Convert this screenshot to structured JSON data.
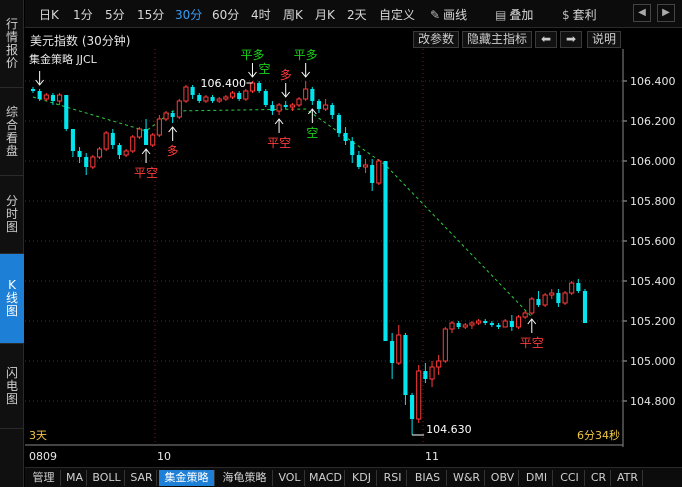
{
  "left_nav": [
    {
      "label": "行情报价",
      "active": false
    },
    {
      "label": "综合看盘",
      "active": false
    },
    {
      "label": "分时图",
      "active": false
    },
    {
      "label": "K线图",
      "active": true
    },
    {
      "label": "闪电图",
      "active": false
    }
  ],
  "toolbar": {
    "periods": [
      "日K",
      "1分",
      "5分",
      "15分",
      "30分",
      "60分",
      "4时",
      "周K",
      "月K",
      "2天",
      "自定义"
    ],
    "active_period": "30分",
    "draw_line": "画线",
    "overlay": "叠加",
    "arbitrage": "套利"
  },
  "chart_header": {
    "title": "美元指数 (30分钟)",
    "change_params": "改参数",
    "hide_indicator": "隐藏主指标",
    "explain": "说明"
  },
  "chart_data": {
    "type": "candlestick",
    "indicator_name": "集金策略 JJCL",
    "ylim": [
      104.63,
      106.43
    ],
    "y_ticks": [
      "106.400",
      "106.200",
      "106.000",
      "105.800",
      "105.600",
      "105.400",
      "105.200",
      "105.000",
      "104.800"
    ],
    "x_ticks": [
      "0809",
      "10",
      "11"
    ],
    "candles": [
      [
        106.36,
        106.37,
        106.34,
        106.35
      ],
      [
        106.35,
        106.36,
        106.3,
        106.31
      ],
      [
        106.31,
        106.34,
        106.3,
        106.33
      ],
      [
        106.33,
        106.34,
        106.28,
        106.3
      ],
      [
        106.3,
        106.34,
        106.28,
        106.33
      ],
      [
        106.33,
        106.33,
        106.15,
        106.16
      ],
      [
        106.16,
        106.16,
        106.02,
        106.05
      ],
      [
        106.05,
        106.07,
        105.99,
        106.02
      ],
      [
        106.02,
        106.04,
        105.93,
        105.97
      ],
      [
        105.97,
        106.03,
        105.96,
        106.02
      ],
      [
        106.02,
        106.07,
        106.01,
        106.06
      ],
      [
        106.06,
        106.15,
        106.05,
        106.14
      ],
      [
        106.14,
        106.16,
        106.06,
        106.08
      ],
      [
        106.08,
        106.09,
        106.01,
        106.03
      ],
      [
        106.03,
        106.06,
        106.02,
        106.05
      ],
      [
        106.05,
        106.13,
        106.04,
        106.12
      ],
      [
        106.12,
        106.17,
        106.11,
        106.16
      ],
      [
        106.16,
        106.21,
        106.08,
        106.08
      ],
      [
        106.08,
        106.14,
        106.07,
        106.13
      ],
      [
        106.13,
        106.23,
        106.12,
        106.21
      ],
      [
        106.21,
        106.25,
        106.2,
        106.24
      ],
      [
        106.24,
        106.25,
        106.19,
        106.22
      ],
      [
        106.22,
        106.31,
        106.21,
        106.3
      ],
      [
        106.3,
        106.38,
        106.29,
        106.37
      ],
      [
        106.37,
        106.38,
        106.31,
        106.33
      ],
      [
        106.33,
        106.34,
        106.29,
        106.3
      ],
      [
        106.3,
        106.33,
        106.29,
        106.32
      ],
      [
        106.32,
        106.33,
        106.29,
        106.3
      ],
      [
        106.3,
        106.32,
        106.29,
        106.31
      ],
      [
        106.31,
        106.33,
        106.3,
        106.32
      ],
      [
        106.32,
        106.35,
        106.31,
        106.34
      ],
      [
        106.34,
        106.35,
        106.3,
        106.31
      ],
      [
        106.31,
        106.36,
        106.3,
        106.35
      ],
      [
        106.35,
        106.4,
        106.34,
        106.39
      ],
      [
        106.39,
        106.4,
        106.34,
        106.35
      ],
      [
        106.35,
        106.36,
        106.27,
        106.28
      ],
      [
        106.28,
        106.3,
        106.23,
        106.25
      ],
      [
        106.25,
        106.29,
        106.23,
        106.28
      ],
      [
        106.28,
        106.3,
        106.26,
        106.27
      ],
      [
        106.27,
        106.29,
        106.25,
        106.28
      ],
      [
        106.28,
        106.32,
        106.27,
        106.31
      ],
      [
        106.31,
        106.4,
        106.3,
        106.36
      ],
      [
        106.36,
        106.37,
        106.28,
        106.3
      ],
      [
        106.3,
        106.31,
        106.24,
        106.26
      ],
      [
        106.26,
        106.31,
        106.25,
        106.28
      ],
      [
        106.28,
        106.29,
        106.21,
        106.23
      ],
      [
        106.23,
        106.24,
        106.12,
        106.14
      ],
      [
        106.14,
        106.17,
        106.08,
        106.1
      ],
      [
        106.1,
        106.12,
        105.99,
        106.03
      ],
      [
        106.03,
        106.05,
        105.96,
        105.97
      ],
      [
        105.97,
        106.01,
        105.94,
        105.98
      ],
      [
        105.98,
        106.01,
        105.85,
        105.89
      ],
      [
        105.89,
        106.01,
        105.88,
        106.0
      ],
      [
        106.0,
        106.0,
        105.1,
        105.1
      ],
      [
        105.1,
        105.14,
        104.91,
        104.99
      ],
      [
        104.99,
        105.18,
        104.98,
        105.13
      ],
      [
        105.13,
        105.14,
        104.78,
        104.83
      ],
      [
        104.83,
        104.84,
        104.63,
        104.71
      ],
      [
        104.71,
        104.98,
        104.69,
        104.95
      ],
      [
        104.95,
        104.99,
        104.89,
        104.91
      ],
      [
        104.91,
        105.0,
        104.87,
        104.97
      ],
      [
        104.97,
        105.03,
        104.93,
        105.0
      ],
      [
        105.0,
        105.17,
        104.99,
        105.16
      ],
      [
        105.16,
        105.2,
        105.14,
        105.19
      ],
      [
        105.19,
        105.2,
        105.16,
        105.17
      ],
      [
        105.17,
        105.19,
        105.16,
        105.18
      ],
      [
        105.18,
        105.2,
        105.16,
        105.19
      ],
      [
        105.19,
        105.21,
        105.18,
        105.2
      ],
      [
        105.2,
        105.21,
        105.18,
        105.19
      ],
      [
        105.19,
        105.2,
        105.17,
        105.18
      ],
      [
        105.18,
        105.19,
        105.16,
        105.17
      ],
      [
        105.17,
        105.21,
        105.17,
        105.2
      ],
      [
        105.2,
        105.23,
        105.15,
        105.17
      ],
      [
        105.17,
        105.23,
        105.16,
        105.22
      ],
      [
        105.22,
        105.25,
        105.21,
        105.24
      ],
      [
        105.24,
        105.32,
        105.23,
        105.31
      ],
      [
        105.31,
        105.35,
        105.27,
        105.28
      ],
      [
        105.28,
        105.34,
        105.27,
        105.33
      ],
      [
        105.33,
        105.36,
        105.31,
        105.34
      ],
      [
        105.34,
        105.36,
        105.27,
        105.29
      ],
      [
        105.29,
        105.35,
        105.28,
        105.34
      ],
      [
        105.34,
        105.4,
        105.33,
        105.39
      ],
      [
        105.39,
        105.41,
        105.34,
        105.35
      ],
      [
        105.35,
        105.36,
        105.19,
        105.19
      ]
    ],
    "signal_line": [
      [
        0,
        106.32
      ],
      [
        17,
        106.15
      ],
      [
        21,
        106.25
      ],
      [
        41,
        106.26
      ],
      [
        53,
        105.98
      ],
      [
        75,
        105.22
      ]
    ],
    "signals": [
      {
        "idx": 1,
        "text": "",
        "color": "#ffffff",
        "dir": "down"
      },
      {
        "idx": 17,
        "text": "平空",
        "color": "#ff3b3b",
        "dir": "up"
      },
      {
        "idx": 21,
        "text": "多",
        "color": "#ff3b3b",
        "dir": "up"
      },
      {
        "idx": 33,
        "text": "平多",
        "color": "#19d019",
        "dir": "down",
        "text2": "空"
      },
      {
        "idx": 37,
        "text": "平空",
        "color": "#ff3b3b",
        "dir": "up"
      },
      {
        "idx": 38,
        "text": "多",
        "color": "#ff3b3b",
        "dir": "down"
      },
      {
        "idx": 41,
        "text": "平多",
        "color": "#19d019",
        "dir": "down"
      },
      {
        "idx": 42,
        "text": "空",
        "color": "#19d019",
        "dir": "up"
      },
      {
        "idx": 75,
        "text": "平空",
        "color": "#ff3b3b",
        "dir": "up"
      }
    ],
    "high_label": "106.400",
    "high_idx": 33,
    "low_label": "104.630",
    "low_idx": 57,
    "left_info": "3天",
    "right_info": "6分34秒",
    "up_color": "#ff3b3b",
    "down_color": "#00e5ee",
    "grid_color": "#7a1a1a"
  },
  "bottom_tabs": [
    {
      "label": "管理",
      "active": false
    },
    {
      "label": "MA",
      "active": false
    },
    {
      "label": "BOLL",
      "active": false
    },
    {
      "label": "SAR",
      "active": false
    },
    {
      "label": "集金策略",
      "active": true
    },
    {
      "label": "海龟策略",
      "active": false
    },
    {
      "label": "VOL",
      "active": false
    },
    {
      "label": "MACD",
      "active": false
    },
    {
      "label": "KDJ",
      "active": false
    },
    {
      "label": "RSI",
      "active": false
    },
    {
      "label": "BIAS",
      "active": false
    },
    {
      "label": "W&R",
      "active": false
    },
    {
      "label": "OBV",
      "active": false
    },
    {
      "label": "DMI",
      "active": false
    },
    {
      "label": "CCI",
      "active": false
    },
    {
      "label": "CR",
      "active": false
    },
    {
      "label": "ATR",
      "active": false
    }
  ]
}
